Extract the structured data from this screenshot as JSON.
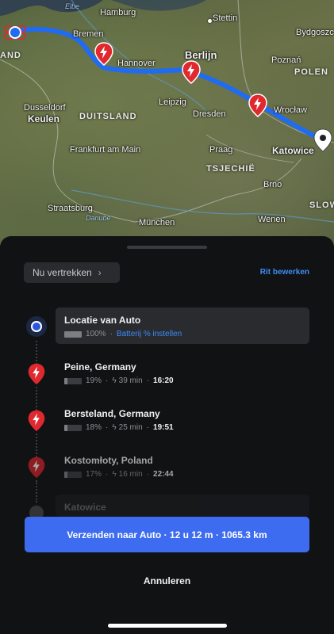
{
  "map": {
    "cities": {
      "hamburg": "Hamburg",
      "stettin": "Stettin",
      "bremen": "Bremen",
      "bydgoszcz": "Bydgoszc",
      "hannover": "Hannover",
      "berlijn": "Berlijn",
      "poznan": "Poznań",
      "polen": "POLEN",
      "duesseldorf": "Dusseldorf",
      "leipzig": "Leipzig",
      "wroclaw": "Wrocław",
      "keulen": "Keulen",
      "duitsland": "DUITSLAND",
      "dresden": "Dresden",
      "katowice": "Katowice",
      "frankfurt": "Frankfurt am Main",
      "praag": "Praag",
      "tsjechie": "TSJECHIË",
      "brno": "Brno",
      "straatsburg": "Straatsburg",
      "slow": "SLOW",
      "muenchen": "München",
      "wenen": "Wenen",
      "and": "AND",
      "elbe": "Elbe",
      "danube": "Danube"
    },
    "route_color": "#1f6bf2"
  },
  "sheet": {
    "depart_label": "Nu vertrekken",
    "edit_trip_label": "Rit bewerken",
    "stops": [
      {
        "name": "Locatie van Auto",
        "battery": "100%",
        "battery_level": 1.0,
        "action": "Batterij % instellen"
      },
      {
        "name": "Peine, Germany",
        "battery": "19%",
        "battery_level": 0.19,
        "charge_time": "39 min",
        "depart_time": "16:20"
      },
      {
        "name": "Bersteland, Germany",
        "battery": "18%",
        "battery_level": 0.18,
        "charge_time": "25 min",
        "depart_time": "19:51"
      },
      {
        "name": "Kostomłoty, Poland",
        "battery": "17%",
        "battery_level": 0.17,
        "charge_time": "16 min",
        "depart_time": "22:44"
      },
      {
        "name": "Katowice"
      }
    ],
    "send_button": "Verzenden naar Auto · 12 u 12 m · 1065.3 km",
    "cancel_label": "Annuleren"
  },
  "colors": {
    "accent": "#3e6cf0",
    "link": "#3e8cf5",
    "charger_red": "#e0282f"
  }
}
